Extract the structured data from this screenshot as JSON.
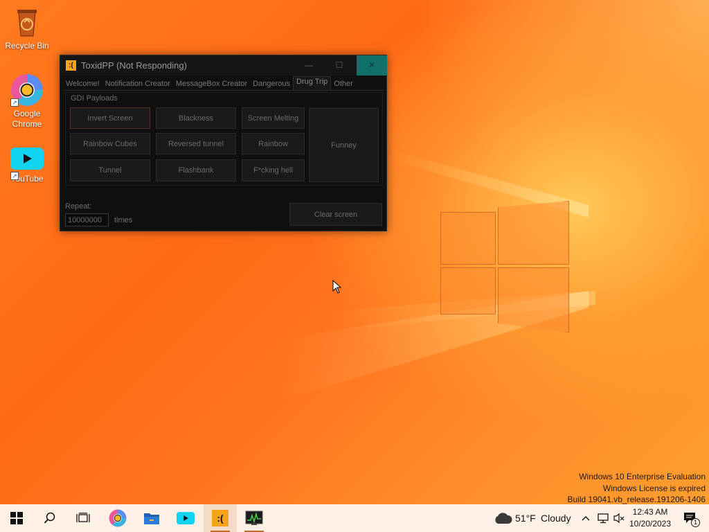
{
  "desktop": {
    "icons": [
      {
        "label": "Recycle Bin"
      },
      {
        "label": "Google Chrome"
      },
      {
        "label": "YouTube"
      }
    ]
  },
  "app": {
    "title": "ToxidPP (Not Responding)",
    "icon_text": ":(",
    "controls": {
      "minimize": "—",
      "maximize": "☐",
      "close": "✕"
    },
    "tabs": [
      "Welcome!",
      "Notification Creator",
      "MessageBox Creator",
      "Dangerous",
      "Drug Trip",
      "Other"
    ],
    "active_tab": "Drug Trip",
    "group_label": "GDI Payloads",
    "buttons": {
      "invert_screen": "Invert Screen",
      "blackness": "Blackness",
      "screen_melting": "Screen Melting",
      "rainbow_cubes": "Rainbow Cubes",
      "reversed_tunnel": "Reversed tunnel",
      "rainbow": "Rainbow",
      "tunnel": "Tunnel",
      "flashbank": "Flashbank",
      "fucking_hell": "F*cking hell",
      "funney": "Funney",
      "clear_screen": "Clear screen"
    },
    "repeat_label": "Repeat:",
    "repeat_value": "10000000",
    "times_label": "times"
  },
  "watermark": {
    "line1": "Windows 10 Enterprise Evaluation",
    "line2": "Windows License is expired",
    "line3": "Build 19041.vb_release.191206-1406"
  },
  "taskbar": {
    "weather_temp": "51°F",
    "weather_desc": "Cloudy",
    "time": "12:43 AM",
    "date": "10/20/2023",
    "notification_count": "1"
  },
  "colors": {
    "accent_close": "#11706a",
    "app_icon": "#f7a21b",
    "taskbar_bg": "#fdf1e6"
  }
}
